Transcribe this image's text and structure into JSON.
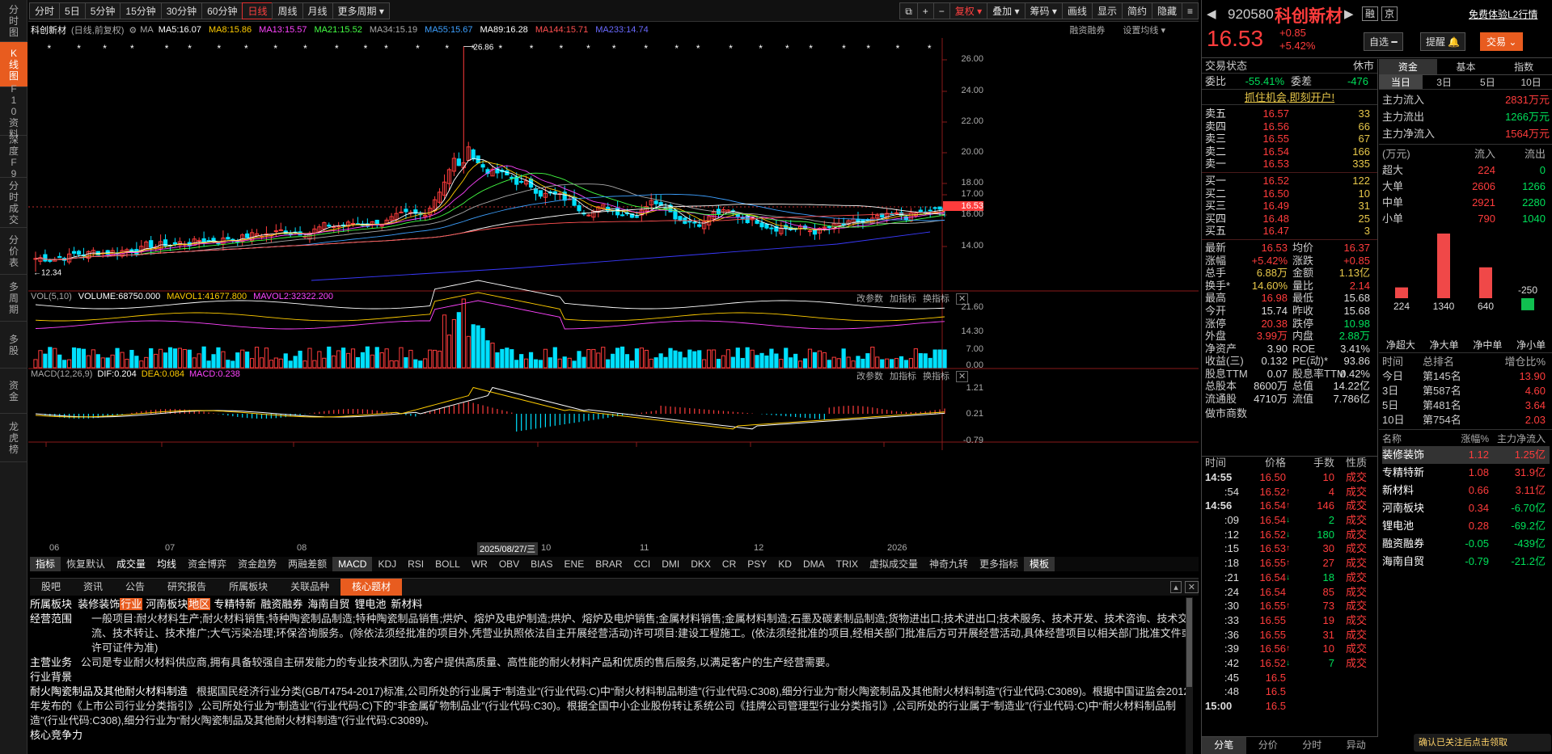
{
  "left_nav": [
    "分时图",
    "K线图",
    "F10资料",
    "深度F9",
    "分时成交",
    "分价表",
    "多周期",
    "多股",
    "资金",
    "龙虎榜"
  ],
  "toolbar": {
    "periods": [
      "分时",
      "5日",
      "5分钟",
      "15分钟",
      "30分钟",
      "60分钟",
      "日线",
      "周线",
      "月线",
      "更多周期"
    ],
    "active": "日线",
    "right": [
      "复权",
      "叠加",
      "筹码",
      "画线",
      "显示",
      "简约",
      "隐藏"
    ]
  },
  "chart_hdr": {
    "name": "科创新材",
    "mode": "(日线,前复权)",
    "ma_label": "MA",
    "ma": [
      "MA5:16.07",
      "MA8:15.86",
      "MA13:15.57",
      "MA21:15.52",
      "MA34:15.19",
      "MA55:15.67",
      "MA89:16.28",
      "MA144:15.71",
      "MA233:14.74"
    ],
    "right": [
      "融资融券",
      "设置均线"
    ]
  },
  "price_axis": [
    "26.00",
    "24.00",
    "22.00",
    "20.00",
    "18.00",
    "17.00",
    "16.53",
    "16.00",
    "14.00"
  ],
  "annotations": {
    "high": "26.86",
    "low": "12.34"
  },
  "vol_hdr": {
    "title": "VOL(5,10)",
    "volume": "VOLUME:68750.000",
    "mavol1": "MAVOL1:41677.800",
    "mavol2": "MAVOL2:32322.200",
    "right": [
      "改参数",
      "加指标",
      "换指标"
    ]
  },
  "vol_axis": [
    "21.60",
    "14.30",
    "7.00",
    "0.00"
  ],
  "macd_hdr": {
    "title": "MACD(12,26,9)",
    "dif": "DIF:0.204",
    "dea": "DEA:0.084",
    "macd": "MACD:0.238",
    "right": [
      "改参数",
      "加指标",
      "换指标"
    ]
  },
  "macd_axis": [
    "1.21",
    "0.21",
    "-0.79"
  ],
  "date_axis": {
    "labels": [
      "06",
      "07",
      "08",
      "10",
      "11",
      "12",
      "2026"
    ],
    "cursor": "2025/08/27/三"
  },
  "ind_tabs": [
    "指标",
    "恢复默认",
    "成交量",
    "均线",
    "资金博弈",
    "资金趋势",
    "两融差额",
    "MACD",
    "KDJ",
    "RSI",
    "BOLL",
    "WR",
    "OBV",
    "BIAS",
    "ENE",
    "BRAR",
    "CCI",
    "DMI",
    "DKX",
    "CR",
    "PSY",
    "KD",
    "DMA",
    "TRIX",
    "虚拟成交量",
    "神奇九转",
    "更多指标",
    "模板"
  ],
  "bot_tabs": [
    "股吧",
    "资讯",
    "公告",
    "研究报告",
    "所属板块",
    "关联品种",
    "核心题材"
  ],
  "info": {
    "sector_label": "所属板块",
    "sectors": [
      "装修装饰",
      "行业",
      "河南板块",
      "地区",
      "专精特新",
      "融资融券",
      "海南自贸",
      "锂电池",
      "新材料"
    ],
    "scope_label": "经营范围",
    "scope": "一般项目:耐火材料生产;耐火材料销售;特种陶瓷制品制造;特种陶瓷制品销售;烘炉、熔炉及电炉制造;烘炉、熔炉及电炉销售;金属材料销售;金属材料制造;石墨及碳素制品制造;货物进出口;技术进出口;技术服务、技术开发、技术咨询、技术交流、技术转让、技术推广;大气污染治理;环保咨询服务。(除依法须经批准的项目外,凭营业执照依法自主开展经营活动)许可项目:建设工程施工。(依法须经批准的项目,经相关部门批准后方可开展经营活动,具体经营项目以相关部门批准文件或许可证件为准)",
    "biz_label": "主营业务",
    "biz": "公司是专业耐火材料供应商,拥有具备较强自主研发能力的专业技术团队,为客户提供高质量、高性能的耐火材料产品和优质的售后服务,以满足客户的生产经营需要。",
    "bg_label": "行业背景",
    "bg_title": "耐火陶瓷制品及其他耐火材料制造",
    "bg": "根据国民经济行业分类(GB/T4754-2017)标准,公司所处的行业属于“制造业”(行业代码:C)中“耐火材料制品制造”(行业代码:C308),细分行业为“耐火陶瓷制品及其他耐火材料制造”(行业代码:C3089)。根据中国证监会2012年发布的《上市公司行业分类指引》,公司所处行业为“制造业”(行业代码:C)下的“非金属矿物制品业”(行业代码:C30)。根据全国中小企业股份转让系统公司《挂牌公司管理型行业分类指引》,公司所处的行业属于“制造业”(行业代码:C)中“耐火材料制品制造”(行业代码:C308),细分行业为“耐火陶瓷制品及其他耐火材料制造”(行业代码:C3089)。",
    "next": "核心竞争力"
  },
  "stock": {
    "code": "920580",
    "name": "科创新材",
    "price": "16.53",
    "chg": "+0.85",
    "pct": "+5.42%",
    "badges": [
      "融",
      "京"
    ],
    "l2": "免费体验L2行情",
    "btns": [
      "自选",
      "提醒",
      "交易"
    ]
  },
  "trade_status": {
    "label": "交易状态",
    "value": "休市",
    "wb": "委比",
    "wb_v": "-55.41%",
    "wc": "委差",
    "wc_v": "-476",
    "promo": "抓住机会,即刻开户!"
  },
  "asks": [
    [
      "卖五",
      "16.57",
      "33"
    ],
    [
      "卖四",
      "16.56",
      "66"
    ],
    [
      "卖三",
      "16.55",
      "67"
    ],
    [
      "卖二",
      "16.54",
      "166"
    ],
    [
      "卖一",
      "16.53",
      "335"
    ]
  ],
  "bids": [
    [
      "买一",
      "16.52",
      "122"
    ],
    [
      "买二",
      "16.50",
      "10"
    ],
    [
      "买三",
      "16.49",
      "31"
    ],
    [
      "买四",
      "16.48",
      "25"
    ],
    [
      "买五",
      "16.47",
      "3"
    ]
  ],
  "quote": [
    [
      "最新",
      "16.53",
      "r",
      "均价",
      "16.37",
      "r"
    ],
    [
      "涨幅",
      "+5.42%",
      "r",
      "涨跌",
      "+0.85",
      "r"
    ],
    [
      "总手",
      "6.88万",
      "y",
      "金额",
      "1.13亿",
      "y"
    ],
    [
      "换手*",
      "14.60%",
      "y",
      "量比",
      "2.14",
      "r"
    ],
    [
      "最高",
      "16.98",
      "r",
      "最低",
      "15.68",
      "w"
    ],
    [
      "今开",
      "15.74",
      "w",
      "昨收",
      "15.68",
      "w"
    ],
    [
      "涨停",
      "20.38",
      "r",
      "跌停",
      "10.98",
      "g"
    ],
    [
      "外盘",
      "3.99万",
      "r",
      "内盘",
      "2.88万",
      "g"
    ],
    [
      "净资产",
      "3.90",
      "w",
      "ROE",
      "3.41%",
      "w"
    ],
    [
      "收益(三)",
      "0.132",
      "w",
      "PE(动)*",
      "93.86",
      "w"
    ],
    [
      "股息TTM",
      "0.07",
      "w",
      "股息率TTM",
      "0.42%",
      "w"
    ],
    [
      "总股本",
      "8600万",
      "w",
      "总值",
      "14.22亿",
      "w"
    ],
    [
      "流通股",
      "4710万",
      "w",
      "流值",
      "7.786亿",
      "w"
    ]
  ],
  "market_maker": "做市商数",
  "ticks_hdr": [
    "时间",
    "价格",
    "手数",
    "性质"
  ],
  "ticks": [
    [
      "14:55",
      "16.50",
      "",
      "10",
      "成交"
    ],
    [
      ":54",
      "16.52",
      "up",
      "4",
      "成交"
    ],
    [
      "14:56",
      "16.54",
      "up",
      "146",
      "成交"
    ],
    [
      ":09",
      "16.54",
      "down",
      "2",
      "成交"
    ],
    [
      ":12",
      "16.52",
      "down",
      "180",
      "成交"
    ],
    [
      ":15",
      "16.53",
      "up",
      "30",
      "成交"
    ],
    [
      ":18",
      "16.55",
      "up",
      "27",
      "成交"
    ],
    [
      ":21",
      "16.54",
      "down",
      "18",
      "成交"
    ],
    [
      ":24",
      "16.54",
      "",
      "85",
      "成交"
    ],
    [
      ":30",
      "16.55",
      "up",
      "73",
      "成交"
    ],
    [
      ":33",
      "16.55",
      "",
      "19",
      "成交"
    ],
    [
      ":36",
      "16.55",
      "",
      "31",
      "成交"
    ],
    [
      ":39",
      "16.56",
      "up",
      "10",
      "成交"
    ],
    [
      ":42",
      "16.52",
      "down",
      "7",
      "成交"
    ],
    [
      ":45",
      "16.5",
      "",
      "",
      ""
    ],
    [
      ":48",
      "16.5",
      "",
      "",
      ""
    ],
    [
      "15:00",
      "16.5",
      "",
      "",
      ""
    ]
  ],
  "rt_tabs": [
    "分笔",
    "分价",
    "分时",
    "异动"
  ],
  "fund_tabs": [
    "资金",
    "基本",
    "指数"
  ],
  "fund_sub": [
    "当日",
    "3日",
    "5日",
    "10日"
  ],
  "fund_flow": [
    [
      "主力流入",
      "2831万元",
      "r"
    ],
    [
      "主力流出",
      "1266万元",
      "g"
    ],
    [
      "主力净流入",
      "1564万元",
      "r"
    ]
  ],
  "fund_tbl_hdr": [
    "(万元)",
    "流入",
    "流出"
  ],
  "fund_tbl": [
    [
      "超大",
      "224",
      "0"
    ],
    [
      "大单",
      "2606",
      "1266"
    ],
    [
      "中单",
      "2921",
      "2280"
    ],
    [
      "小单",
      "790",
      "1040"
    ]
  ],
  "net_bars": {
    "labels": [
      "净超大",
      "净大单",
      "净中单",
      "净小单"
    ],
    "values": [
      224,
      1340,
      640,
      -250
    ]
  },
  "rank_hdr": [
    "时间",
    "总排名",
    "增仓比%"
  ],
  "rank": [
    [
      "今日",
      "第145名",
      "13.90"
    ],
    [
      "3日",
      "第587名",
      "4.60"
    ],
    [
      "5日",
      "第481名",
      "3.64"
    ],
    [
      "10日",
      "第754名",
      "2.03"
    ]
  ],
  "sec_hdr": [
    "名称",
    "涨幅%",
    "主力净流入"
  ],
  "sectors_tbl": [
    [
      "装修装饰",
      "1.12",
      "1.25亿"
    ],
    [
      "专精特新",
      "1.08",
      "31.9亿"
    ],
    [
      "新材料",
      "0.66",
      "3.11亿"
    ],
    [
      "河南板块",
      "0.34",
      "-6.70亿"
    ],
    [
      "锂电池",
      "0.28",
      "-69.2亿"
    ],
    [
      "融资融券",
      "-0.05",
      "-439亿"
    ],
    [
      "海南自贸",
      "-0.79",
      "-21.2亿"
    ]
  ],
  "bottom_ad": "确认已关注后点击领取",
  "colors": {
    "up": "#ff3c3c",
    "down": "#00e0ff",
    "accent": "#e85c1f"
  }
}
